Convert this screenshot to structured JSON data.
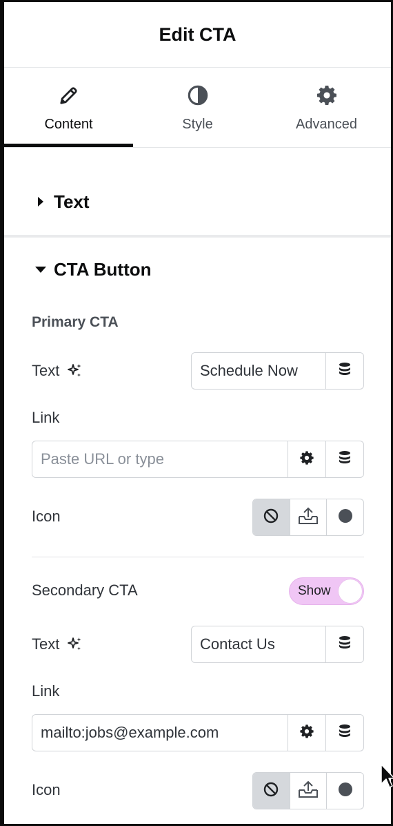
{
  "header": {
    "title": "Edit CTA"
  },
  "tabs": [
    {
      "label": "Content",
      "icon": "pencil-icon",
      "active": true
    },
    {
      "label": "Style",
      "icon": "contrast-icon",
      "active": false
    },
    {
      "label": "Advanced",
      "icon": "gear-icon",
      "active": false
    }
  ],
  "sections": {
    "text": {
      "title": "Text",
      "expanded": false
    },
    "cta_button": {
      "title": "CTA Button",
      "expanded": true
    }
  },
  "primary": {
    "heading": "Primary CTA",
    "text_label": "Text",
    "text_value": "Schedule Now",
    "link_label": "Link",
    "link_value": "",
    "link_placeholder": "Paste URL or type",
    "icon_label": "Icon",
    "icon_selected": "none"
  },
  "secondary": {
    "label": "Secondary CTA",
    "toggle_label": "Show",
    "toggle_on": true,
    "text_label": "Text",
    "text_value": "Contact Us",
    "link_label": "Link",
    "link_value": "mailto:jobs@example.com",
    "link_placeholder": "Paste URL or type",
    "icon_label": "Icon",
    "icon_selected": "none"
  },
  "colors": {
    "toggle_bg": "#f0c6f5",
    "selected_option_bg": "#d5d8dc",
    "tab_active_underline": "#0c0d0e"
  }
}
